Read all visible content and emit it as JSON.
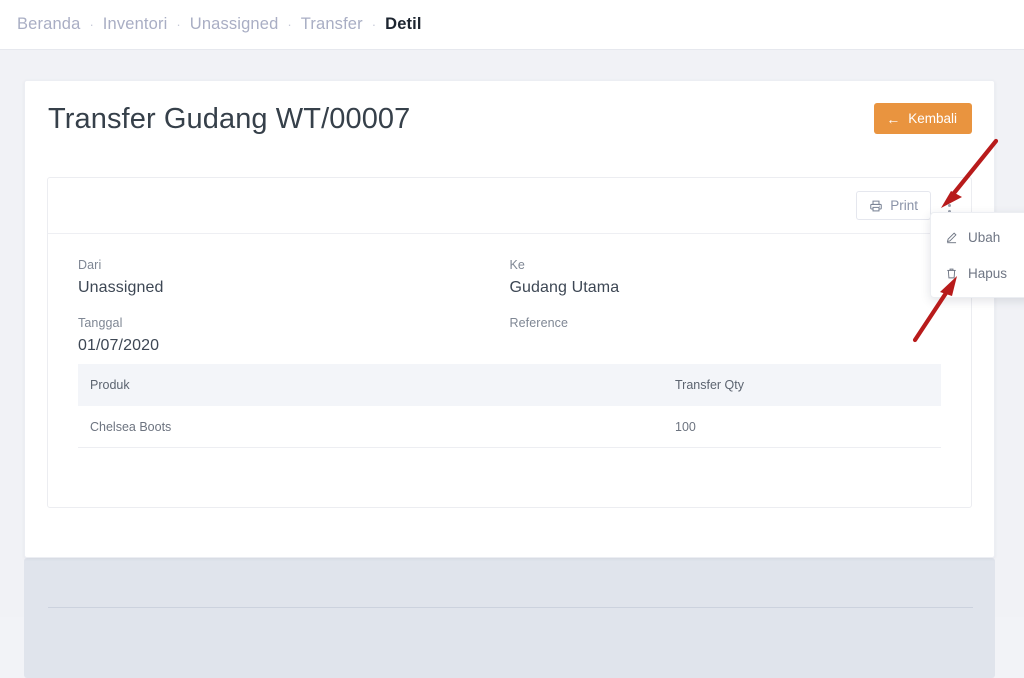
{
  "breadcrumb": {
    "separator": "·",
    "items": [
      {
        "label": "Beranda",
        "active": false
      },
      {
        "label": "Inventori",
        "active": false
      },
      {
        "label": "Unassigned",
        "active": false
      },
      {
        "label": "Transfer",
        "active": false
      },
      {
        "label": "Detil",
        "active": true
      }
    ]
  },
  "card": {
    "title": "Transfer Gudang WT/00007",
    "back_button": {
      "label": "Kembali",
      "icon": "arrow-left-icon",
      "color": "#e9943f"
    }
  },
  "toolbar": {
    "print_label": "Print",
    "print_icon": "printer-icon",
    "kebab_icon": "more-vertical-icon"
  },
  "details": {
    "from": {
      "label": "Dari",
      "value": "Unassigned"
    },
    "to": {
      "label": "Ke",
      "value": "Gudang Utama"
    },
    "date": {
      "label": "Tanggal",
      "value": "01/07/2020"
    },
    "reference": {
      "label": "Reference",
      "value": ""
    }
  },
  "table": {
    "columns": [
      "Produk",
      "Transfer Qty"
    ],
    "rows": [
      {
        "product": "Chelsea Boots",
        "qty": "100"
      }
    ]
  },
  "dropdown": {
    "items": [
      {
        "label": "Ubah",
        "icon": "pencil-icon"
      },
      {
        "label": "Hapus",
        "icon": "trash-icon"
      }
    ]
  },
  "annotations": {
    "arrow_color": "#b81b1b",
    "arrows": [
      {
        "name": "arrow-to-kebab-menu"
      },
      {
        "name": "arrow-to-hapus-item"
      }
    ]
  }
}
